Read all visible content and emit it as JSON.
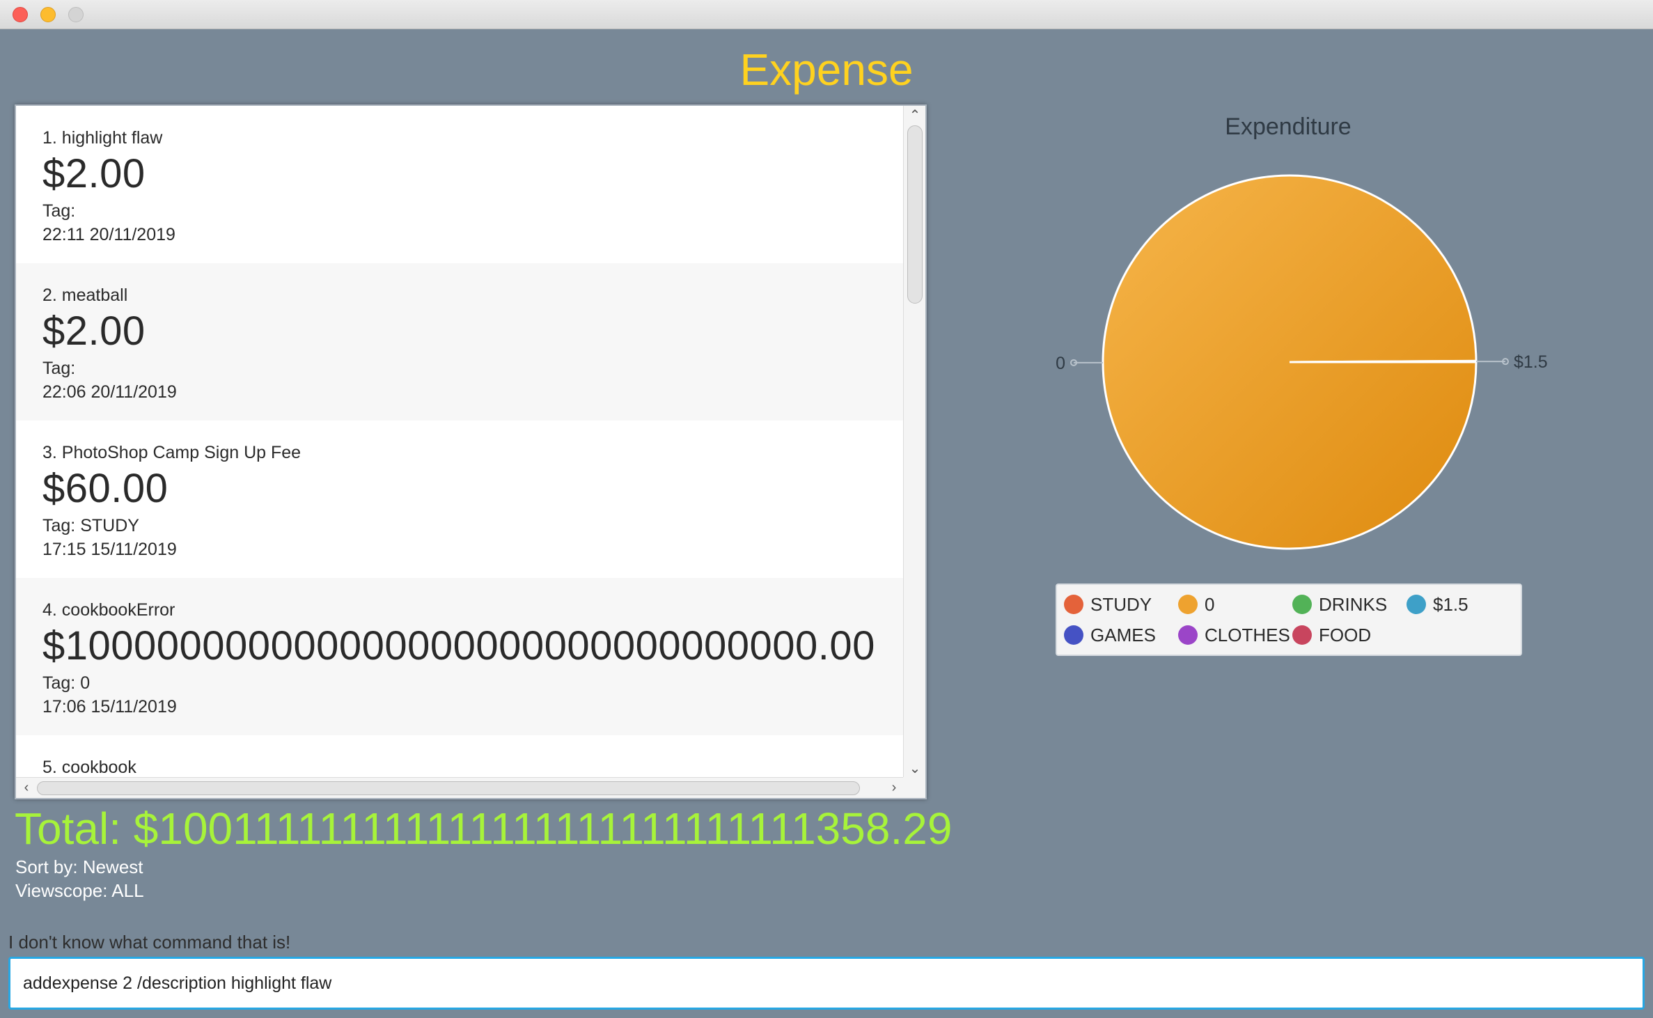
{
  "app": {
    "title": "Expense"
  },
  "expenses": [
    {
      "description": "1. highlight flaw",
      "amount": "$2.00",
      "tag": "Tag:",
      "time": "22:11 20/11/2019"
    },
    {
      "description": "2. meatball",
      "amount": "$2.00",
      "tag": "Tag:",
      "time": "22:06 20/11/2019"
    },
    {
      "description": "3. PhotoShop Camp Sign Up Fee",
      "amount": "$60.00",
      "tag": "Tag: STUDY",
      "time": "17:15 15/11/2019"
    },
    {
      "description": "4. cookbookError",
      "amount": "$100000000000000000000000000000000.00",
      "tag": "Tag: 0",
      "time": "17:06 15/11/2019"
    },
    {
      "description": "5. cookbook",
      "amount": "",
      "tag": "",
      "time": ""
    }
  ],
  "scroll": {
    "up_icon": "chevron-up-icon",
    "down_icon": "chevron-down-icon",
    "left_icon": "chevron-left-icon",
    "right_icon": "chevron-right-icon"
  },
  "summary": {
    "total": "Total: $100111111111111111111111111111358.29",
    "sort": "Sort by: Newest",
    "viewscope": "Viewscope: ALL"
  },
  "feedback": {
    "message": "I don't know what command that is!"
  },
  "command": {
    "value": "addexpense 2 /description highlight flaw"
  },
  "chart_data": {
    "type": "pie",
    "title": "Expenditure",
    "slices": [
      {
        "label": "0",
        "fraction": 0.999,
        "color": "#e89b2a"
      },
      {
        "label": "$1.5",
        "fraction": 0.001,
        "color": "#3ea0c8"
      }
    ],
    "legend": [
      {
        "label": "STUDY",
        "color": "#e4623a"
      },
      {
        "label": "0",
        "color": "#eea22f"
      },
      {
        "label": "DRINKS",
        "color": "#52b257"
      },
      {
        "label": "$1.5",
        "color": "#3ea0c8"
      },
      {
        "label": "GAMES",
        "color": "#4552c4"
      },
      {
        "label": "CLOTHES",
        "color": "#9b45c8"
      },
      {
        "label": "FOOD",
        "color": "#c8455e"
      }
    ],
    "legend_position": "bottom"
  }
}
